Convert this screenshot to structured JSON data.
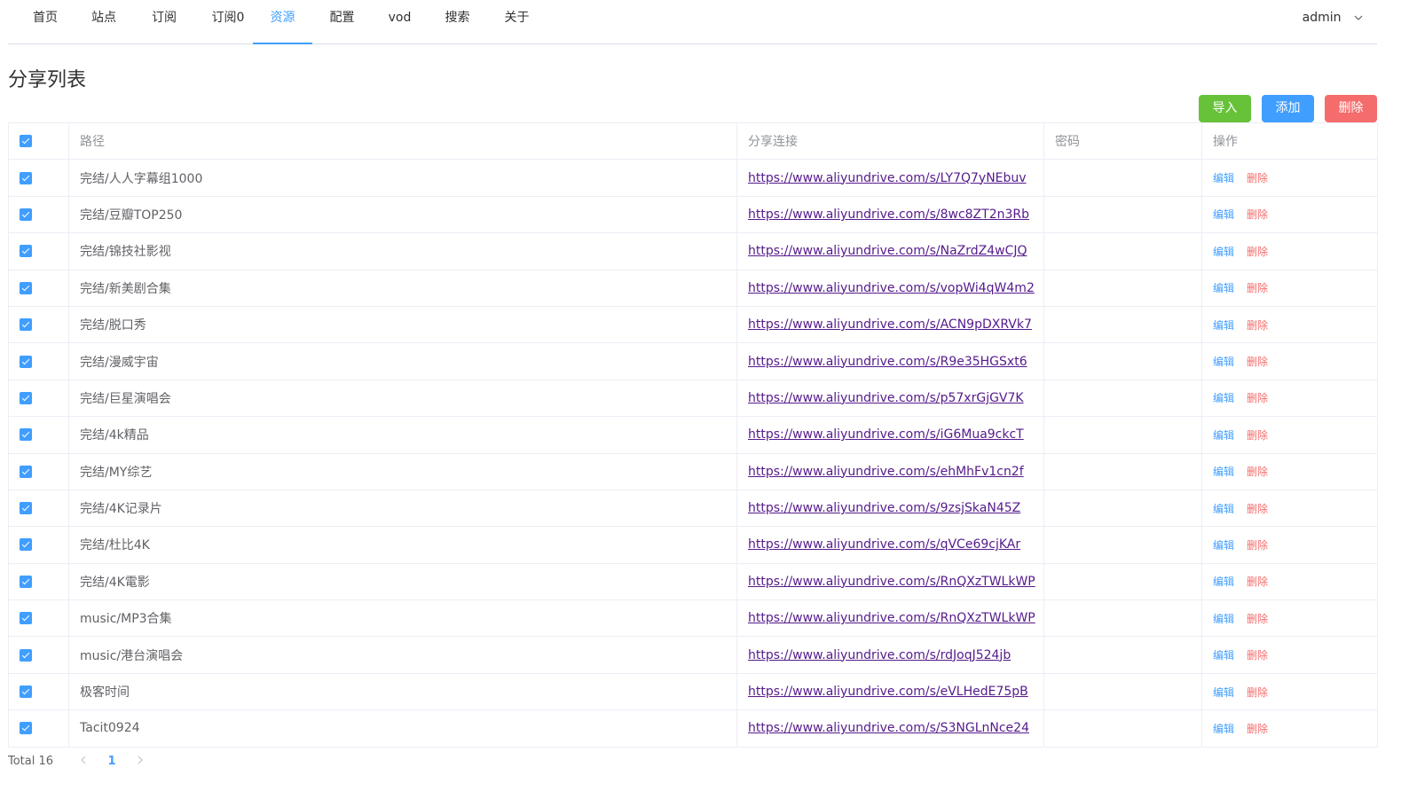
{
  "nav": {
    "items": [
      {
        "label": "首页"
      },
      {
        "label": "站点"
      },
      {
        "label": "订阅"
      },
      {
        "label": "订阅0"
      },
      {
        "label": "资源"
      },
      {
        "label": "配置"
      },
      {
        "label": "vod"
      },
      {
        "label": "搜索"
      },
      {
        "label": "关于"
      }
    ],
    "active_index": 4,
    "user": "admin"
  },
  "page": {
    "title": "分享列表"
  },
  "actions": {
    "import_label": "导入",
    "add_label": "添加",
    "delete_label": "删除"
  },
  "table": {
    "headers": {
      "path": "路径",
      "link": "分享连接",
      "password": "密码",
      "ops": "操作"
    },
    "edit_label": "编辑",
    "delete_label": "删除",
    "rows": [
      {
        "path": "完结/人人字幕组1000",
        "link": "https://www.aliyundrive.com/s/LY7Q7yNEbuv",
        "password": "",
        "checked": true
      },
      {
        "path": "完结/豆瓣TOP250",
        "link": "https://www.aliyundrive.com/s/8wc8ZT2n3Rb",
        "password": "",
        "checked": true
      },
      {
        "path": "完结/锦技社影视",
        "link": "https://www.aliyundrive.com/s/NaZrdZ4wCJQ",
        "password": "",
        "checked": true
      },
      {
        "path": "完结/新美剧合集",
        "link": "https://www.aliyundrive.com/s/vopWi4qW4m2",
        "password": "",
        "checked": true
      },
      {
        "path": "完结/脱口秀",
        "link": "https://www.aliyundrive.com/s/ACN9pDXRVk7",
        "password": "",
        "checked": true
      },
      {
        "path": "完结/漫威宇宙",
        "link": "https://www.aliyundrive.com/s/R9e35HGSxt6",
        "password": "",
        "checked": true
      },
      {
        "path": "完结/巨星演唱会",
        "link": "https://www.aliyundrive.com/s/p57xrGjGV7K",
        "password": "",
        "checked": true
      },
      {
        "path": "完结/4k精品",
        "link": "https://www.aliyundrive.com/s/iG6Mua9ckcT",
        "password": "",
        "checked": true
      },
      {
        "path": "完结/MY综艺",
        "link": "https://www.aliyundrive.com/s/ehMhFv1cn2f",
        "password": "",
        "checked": true
      },
      {
        "path": "完结/4K记录片",
        "link": "https://www.aliyundrive.com/s/9zsjSkaN45Z",
        "password": "",
        "checked": true
      },
      {
        "path": "完结/杜比4K",
        "link": "https://www.aliyundrive.com/s/qVCe69cjKAr",
        "password": "",
        "checked": true
      },
      {
        "path": "完结/4K電影",
        "link": "https://www.aliyundrive.com/s/RnQXzTWLkWP",
        "password": "",
        "checked": true
      },
      {
        "path": "music/MP3合集",
        "link": "https://www.aliyundrive.com/s/RnQXzTWLkWP",
        "password": "",
        "checked": true
      },
      {
        "path": "music/港台演唱会",
        "link": "https://www.aliyundrive.com/s/rdJoqJ524jb",
        "password": "",
        "checked": true
      },
      {
        "path": "极客时间",
        "link": "https://www.aliyundrive.com/s/eVLHedE75pB",
        "password": "",
        "checked": true
      },
      {
        "path": "Tacit0924",
        "link": "https://www.aliyundrive.com/s/S3NGLnNce24",
        "password": "",
        "checked": true
      }
    ]
  },
  "pagination": {
    "total_text": "Total 16",
    "current_page": "1"
  },
  "icons": {
    "user_dropdown": "chevron-down-icon",
    "prev": "chevron-left-icon",
    "next": "chevron-right-icon"
  },
  "colors": {
    "primary": "#409eff",
    "success": "#67c23a",
    "danger": "#f56c6c",
    "link": "#551a8b"
  }
}
